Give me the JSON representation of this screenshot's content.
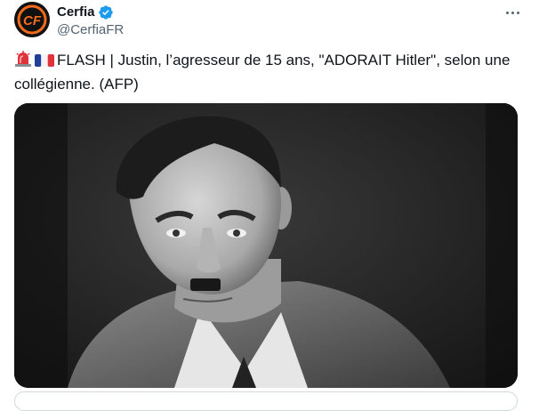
{
  "account": {
    "display_name": "Cerfia",
    "handle": "@CerfiaFR",
    "avatar_letters": "CF",
    "verified_color": "#1d9bf0",
    "brand_color": "#f26b1d"
  },
  "tweet": {
    "emoji_1": "siren-emoji",
    "emoji_2": "france-flag-emoji",
    "text": "FLASH | Justin, l’agresseur de 15 ans, \"ADORAIT Hitler\", selon une collégienne. (AFP)"
  },
  "icons": {
    "more": "more-horizontal-icon",
    "verified": "verified-badge-icon"
  }
}
